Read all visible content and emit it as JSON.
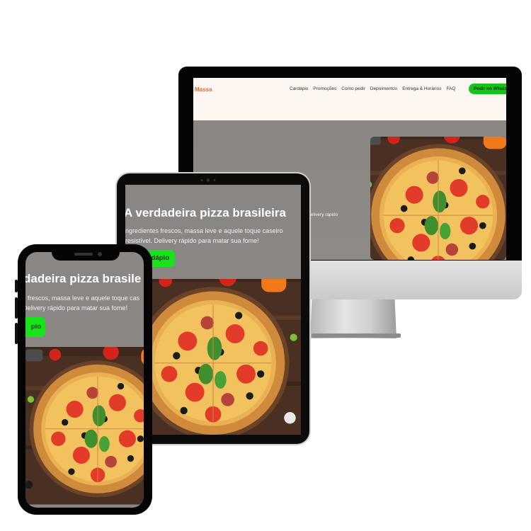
{
  "desktop": {
    "logo": "Massa",
    "nav": [
      "Cardápio",
      "Promoções",
      "Como pedir",
      "Depoimentos",
      "Entrega & Horários",
      "FAQ"
    ],
    "cta": "Pedir no Whats",
    "hero_fragment": "vel. Delivery rápido"
  },
  "tablet": {
    "title": "A verdadeira pizza brasileira",
    "subtitle_line1": "ngredientes frescos, massa leve e aquele toque caseiro",
    "subtitle_line2": "resistível. Delivery rápido para matar sua fome!",
    "button": "rdápio"
  },
  "phone": {
    "title": "dadeira pizza brasile",
    "subtitle_line1": "s frescos, massa leve e aquele toque cas",
    "subtitle_line2": "Delivery rápido para matar sua fome!",
    "button": "pio"
  },
  "colors": {
    "accent_green": "#18e21a",
    "hero_gray": "#8a8683",
    "nav_bg": "#fdf6f1",
    "logo_orange": "#e0693a"
  },
  "icons": [
    "pizza-image",
    "camera-icon"
  ]
}
